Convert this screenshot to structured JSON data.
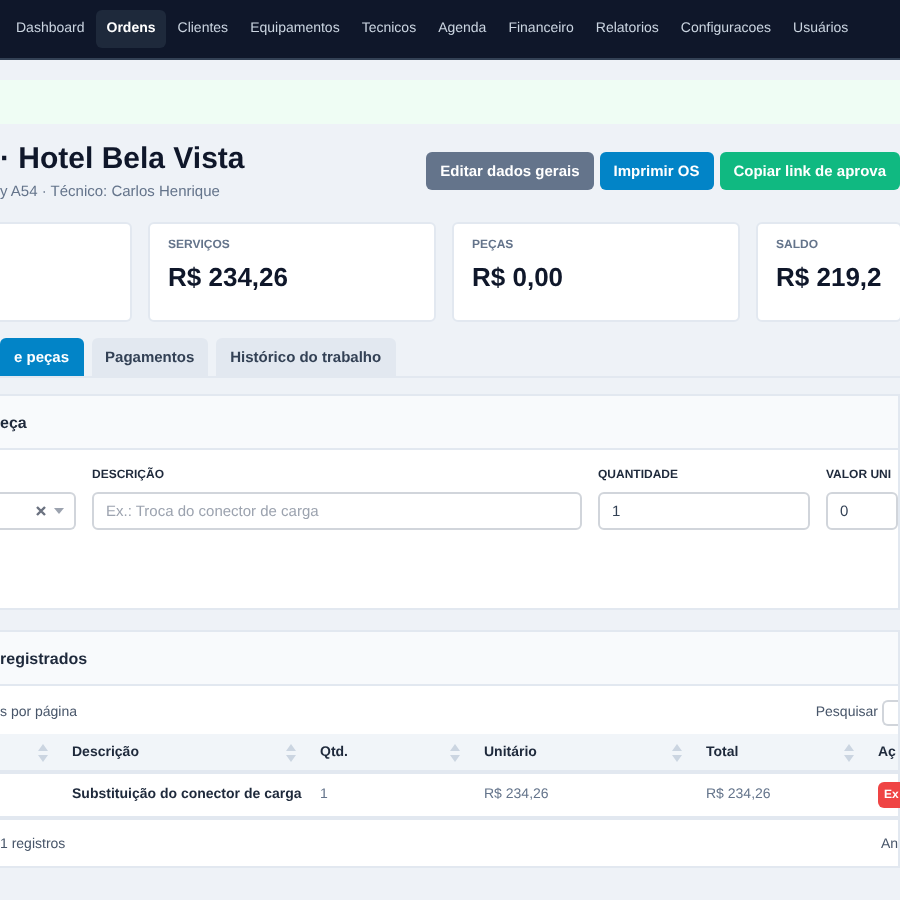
{
  "nav": [
    {
      "label": "Dashboard",
      "selected": false
    },
    {
      "label": "Ordens",
      "selected": true
    },
    {
      "label": "Clientes",
      "selected": false
    },
    {
      "label": "Equipamentos",
      "selected": false
    },
    {
      "label": "Tecnicos",
      "selected": false
    },
    {
      "label": "Agenda",
      "selected": false
    },
    {
      "label": "Financeiro",
      "selected": false
    },
    {
      "label": "Relatorios",
      "selected": false
    },
    {
      "label": "Configuracoes",
      "selected": false
    },
    {
      "label": "Usuários",
      "selected": false
    }
  ],
  "header": {
    "title": "· Hotel Bela Vista",
    "subtitle": "y A54 · Técnico: Carlos Henrique",
    "buttons": [
      {
        "label": "Editar dados gerais",
        "kind": "secondary"
      },
      {
        "label": "Imprimir OS",
        "kind": "primary"
      },
      {
        "label": "Copiar link de aprova",
        "kind": "success"
      }
    ]
  },
  "stats": [
    {
      "kind": "blank"
    },
    {
      "kind": "value",
      "label": "SERVIÇOS",
      "value": "R$ 234,26"
    },
    {
      "kind": "value",
      "label": "PEÇAS",
      "value": "R$ 0,00"
    },
    {
      "kind": "value",
      "label": "SALDO",
      "value": "R$ 219,2"
    }
  ],
  "tabs": [
    {
      "label": "e peças",
      "selected": true
    },
    {
      "label": "Pagamentos",
      "selected": false
    },
    {
      "label": "Histórico do trabalho",
      "selected": false
    }
  ],
  "form_panel": {
    "title": "eça",
    "fields": [
      {
        "kind": "select"
      },
      {
        "kind": "text",
        "label": "DESCRIÇÃO",
        "placeholder": "Ex.: Troca do conector de carga"
      },
      {
        "kind": "text",
        "label": "QUANTIDADE",
        "value": "1"
      },
      {
        "kind": "text",
        "label": "VALOR UNI",
        "value": "0"
      }
    ]
  },
  "list_panel": {
    "title": "registrados",
    "page_size_label": "s por página",
    "search_label": "Pesquisar",
    "table": {
      "columns": [
        "",
        "Descrição",
        "Qtd.",
        "Unitário",
        "Total",
        "Aç"
      ],
      "rows": [
        {
          "cells": [
            "",
            "Substituição do conector de carga",
            "1",
            "R$ 234,26",
            "R$ 234,26"
          ],
          "action": "Ex"
        }
      ]
    },
    "info": "1 registros",
    "pager": "An"
  }
}
